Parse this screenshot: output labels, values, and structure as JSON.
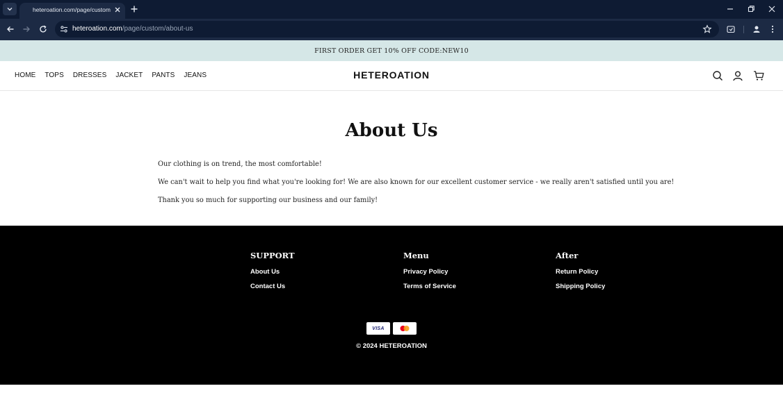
{
  "browser": {
    "tab_title": "heteroation.com/page/custom/about-us",
    "url_host": "heteroation.com",
    "url_path": "/page/custom/about-us"
  },
  "announcement": "FIRST ORDER GET 10% OFF CODE:NEW10",
  "header": {
    "nav": [
      "HOME",
      "TOPS",
      "DRESSES",
      "JACKET",
      "PANTS",
      "JEANS"
    ],
    "logo": "HETEROATION"
  },
  "main": {
    "title": "About Us",
    "paragraphs": [
      "Our clothing is on trend, the most comfortable!",
      "We can't wait to help you find what you're looking for! We are also known for our excellent customer service - we really aren't satisfied until you are!",
      "Thank you so much for supporting our business and our family!"
    ]
  },
  "footer": {
    "columns": [
      {
        "heading": "SUPPORT",
        "links": [
          "About Us",
          "Contact Us"
        ]
      },
      {
        "heading": "Menu",
        "links": [
          "Privacy Policy",
          "Terms of Service"
        ]
      },
      {
        "heading": "After",
        "links": [
          "Return Policy",
          "Shipping Policy"
        ]
      }
    ],
    "payments": [
      "VISA",
      "mastercard-icon"
    ],
    "copyright": "© 2024 HETEROATION"
  },
  "colors": {
    "chrome_dark": "#0e1b33",
    "chrome_toolbar": "#1c2a44",
    "announcement_bg": "#d5e7e7",
    "footer_bg": "#000000"
  }
}
